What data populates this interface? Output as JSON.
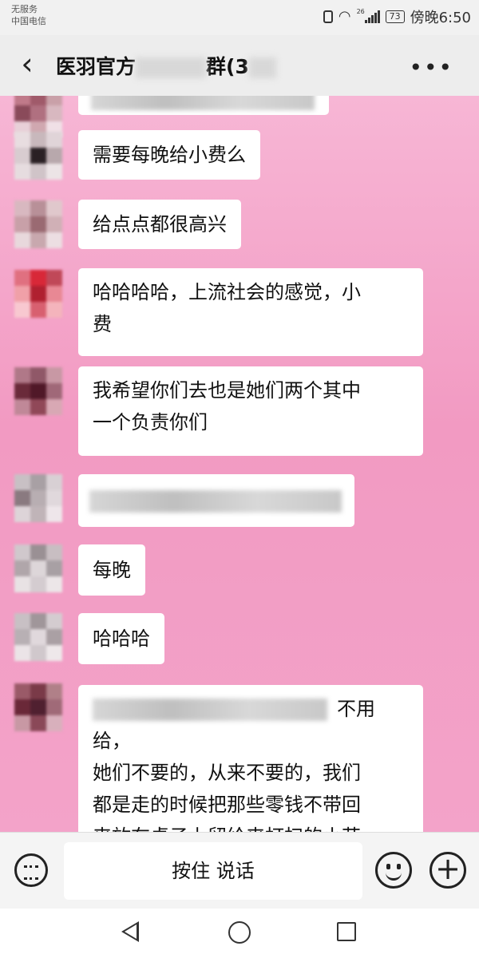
{
  "status_bar": {
    "carrier_line1": "无服务",
    "carrier_line2": "中国电信",
    "network_label": "26",
    "battery": "73",
    "time": "傍晚6:50"
  },
  "header": {
    "back_icon": "chevron-left-icon",
    "title": "医羽官方",
    "title_suffix": "群(3",
    "more_icon": "more-horizontal-icon"
  },
  "messages": [
    {
      "text": ""
    },
    {
      "text": "需要每晚给小费么"
    },
    {
      "text": "给点点都很高兴"
    },
    {
      "line1": "哈哈哈哈，上流社会的感觉，小",
      "line2": "费"
    },
    {
      "line1": "我希望你们去也是她们两个其中",
      "line2": "一个负责你们"
    },
    {
      "text": ""
    },
    {
      "text": "每晚"
    },
    {
      "text": "哈哈哈"
    },
    {
      "line1_visible": "不用给，",
      "line2": "她们不要的，从来不要的，我们",
      "line3": "都是走的时候把那些零钱不带回",
      "line4": "来放在桌子上留给来打扫的小花"
    }
  ],
  "input_bar": {
    "voice_toggle_icon": "keyboard-icon",
    "hold_to_talk": "按住 说话",
    "emoji_icon": "emoji-icon",
    "plus_icon": "plus-icon"
  },
  "nav_bar": {
    "back_icon": "triangle-back-icon",
    "home_icon": "circle-home-icon",
    "recent_icon": "square-recent-icon"
  },
  "colors": {
    "chat_background": "#f29ac2",
    "bubble": "#ffffff",
    "header": "#ededed"
  }
}
